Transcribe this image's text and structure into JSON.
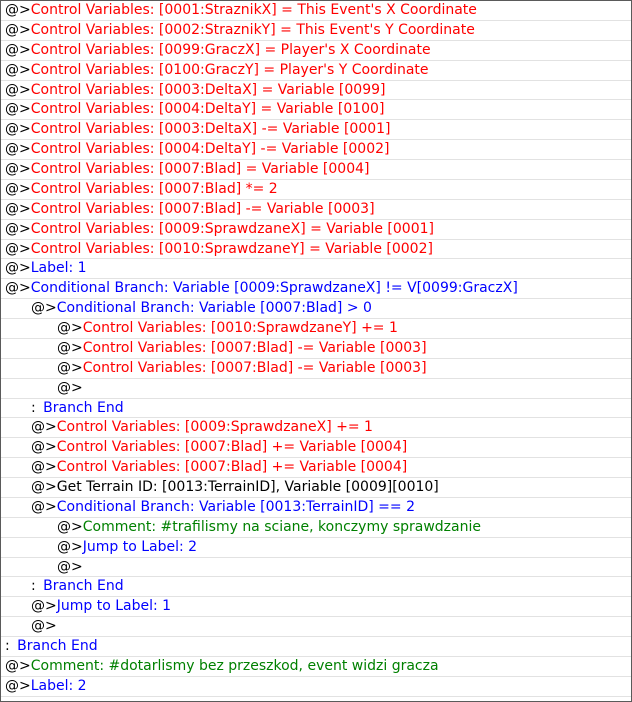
{
  "event_commands": [
    {
      "indent": 0,
      "kind": "cmd",
      "color": "red",
      "text": "Control Variables: [0001:StraznikX] = This Event's X Coordinate"
    },
    {
      "indent": 0,
      "kind": "cmd",
      "color": "red",
      "text": "Control Variables: [0002:StraznikY] = This Event's Y Coordinate"
    },
    {
      "indent": 0,
      "kind": "cmd",
      "color": "red",
      "text": "Control Variables: [0099:GraczX] = Player's X Coordinate"
    },
    {
      "indent": 0,
      "kind": "cmd",
      "color": "red",
      "text": "Control Variables: [0100:GraczY] = Player's Y Coordinate"
    },
    {
      "indent": 0,
      "kind": "cmd",
      "color": "red",
      "text": "Control Variables: [0003:DeltaX] = Variable [0099]"
    },
    {
      "indent": 0,
      "kind": "cmd",
      "color": "red",
      "text": "Control Variables: [0004:DeltaY] = Variable [0100]"
    },
    {
      "indent": 0,
      "kind": "cmd",
      "color": "red",
      "text": "Control Variables: [0003:DeltaX] -= Variable [0001]"
    },
    {
      "indent": 0,
      "kind": "cmd",
      "color": "red",
      "text": "Control Variables: [0004:DeltaY] -= Variable [0002]"
    },
    {
      "indent": 0,
      "kind": "cmd",
      "color": "red",
      "text": "Control Variables: [0007:Blad] = Variable [0004]"
    },
    {
      "indent": 0,
      "kind": "cmd",
      "color": "red",
      "text": "Control Variables: [0007:Blad] *= 2"
    },
    {
      "indent": 0,
      "kind": "cmd",
      "color": "red",
      "text": "Control Variables: [0007:Blad] -= Variable [0003]"
    },
    {
      "indent": 0,
      "kind": "cmd",
      "color": "red",
      "text": "Control Variables: [0009:SprawdzaneX] = Variable [0001]"
    },
    {
      "indent": 0,
      "kind": "cmd",
      "color": "red",
      "text": "Control Variables: [0010:SprawdzaneY] = Variable [0002]"
    },
    {
      "indent": 0,
      "kind": "cmd",
      "color": "blue",
      "text": "Label: 1"
    },
    {
      "indent": 0,
      "kind": "cmd",
      "color": "blue",
      "text": "Conditional Branch: Variable [0009:SprawdzaneX] != V[0099:GraczX]"
    },
    {
      "indent": 1,
      "kind": "cmd",
      "color": "blue",
      "text": "Conditional Branch: Variable [0007:Blad] > 0"
    },
    {
      "indent": 2,
      "kind": "cmd",
      "color": "red",
      "text": "Control Variables: [0010:SprawdzaneY] += 1"
    },
    {
      "indent": 2,
      "kind": "cmd",
      "color": "red",
      "text": "Control Variables: [0007:Blad] -= Variable [0003]"
    },
    {
      "indent": 2,
      "kind": "cmd",
      "color": "red",
      "text": "Control Variables: [0007:Blad] -= Variable [0003]"
    },
    {
      "indent": 2,
      "kind": "empty",
      "color": "black",
      "text": ""
    },
    {
      "indent": 1,
      "kind": "end",
      "color": "blue",
      "text": "Branch End"
    },
    {
      "indent": 1,
      "kind": "cmd",
      "color": "red",
      "text": "Control Variables: [0009:SprawdzaneX] += 1"
    },
    {
      "indent": 1,
      "kind": "cmd",
      "color": "red",
      "text": "Control Variables: [0007:Blad] += Variable [0004]"
    },
    {
      "indent": 1,
      "kind": "cmd",
      "color": "red",
      "text": "Control Variables: [0007:Blad] += Variable [0004]"
    },
    {
      "indent": 1,
      "kind": "cmd",
      "color": "black",
      "text": "Get Terrain ID: [0013:TerrainID], Variable [0009][0010]"
    },
    {
      "indent": 1,
      "kind": "cmd",
      "color": "blue",
      "text": "Conditional Branch: Variable [0013:TerrainID] == 2"
    },
    {
      "indent": 2,
      "kind": "cmd",
      "color": "green",
      "text": "Comment: #trafilismy na sciane, konczymy sprawdzanie"
    },
    {
      "indent": 2,
      "kind": "cmd",
      "color": "blue",
      "text": "Jump to Label: 2"
    },
    {
      "indent": 2,
      "kind": "empty",
      "color": "black",
      "text": ""
    },
    {
      "indent": 1,
      "kind": "end",
      "color": "blue",
      "text": "Branch End"
    },
    {
      "indent": 1,
      "kind": "cmd",
      "color": "blue",
      "text": "Jump to Label: 1"
    },
    {
      "indent": 1,
      "kind": "empty",
      "color": "black",
      "text": ""
    },
    {
      "indent": 0,
      "kind": "end",
      "color": "blue",
      "text": "Branch End"
    },
    {
      "indent": 0,
      "kind": "cmd",
      "color": "green",
      "text": "Comment: #dotarlismy bez przeszkod, event widzi gracza"
    },
    {
      "indent": 0,
      "kind": "cmd",
      "color": "blue",
      "text": "Label: 2"
    }
  ],
  "markers": {
    "command": "@>",
    "end": ": "
  },
  "colors": {
    "red": "#ff0000",
    "blue": "#0000ff",
    "green": "#008000",
    "black": "#000000",
    "border": "#5a5a5a"
  }
}
